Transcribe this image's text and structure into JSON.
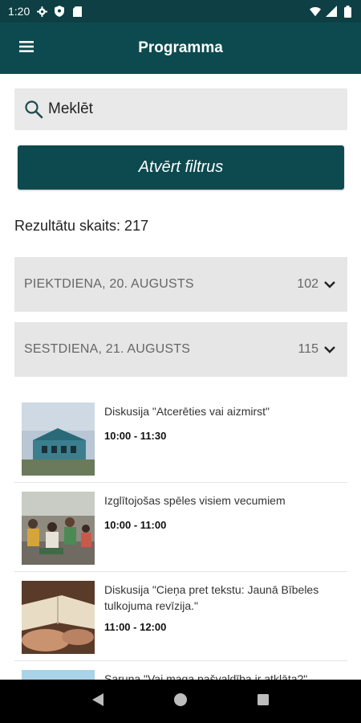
{
  "status_bar": {
    "time": "1:20"
  },
  "app_bar": {
    "title": "Programma"
  },
  "search": {
    "placeholder": "Meklēt"
  },
  "filter_button": {
    "label": "Atvērt filtrus"
  },
  "results": {
    "text": "Rezultātu skaits: 217"
  },
  "day_groups": [
    {
      "label": "PIEKTDIENA, 20. AUGUSTS",
      "count": "102"
    },
    {
      "label": "SESTDIENA, 21. AUGUSTS",
      "count": "115"
    }
  ],
  "events": [
    {
      "title": "Diskusija \"Atcerēties vai aizmirst\"",
      "time": "10:00 - 11:30"
    },
    {
      "title": "Izglītojošas spēles visiem vecumiem",
      "time": "10:00 - 11:00"
    },
    {
      "title": "Diskusija \"Cieņa pret tekstu: Jaunā Bībeles tulkojuma revīzija.\"",
      "time": "11:00 - 12:00"
    },
    {
      "title": "Saruna \"Vai maga pašvaldība ir atklāta?\"",
      "time": ""
    }
  ],
  "colors": {
    "primary": "#0d4a4f",
    "status_bar": "#0d3f44",
    "group_bg": "#e6e6e6",
    "search_bg": "#e9e9e9"
  },
  "icons": {
    "menu": "hamburger-icon",
    "search": "search-icon",
    "chevron": "chevron-down-icon"
  }
}
